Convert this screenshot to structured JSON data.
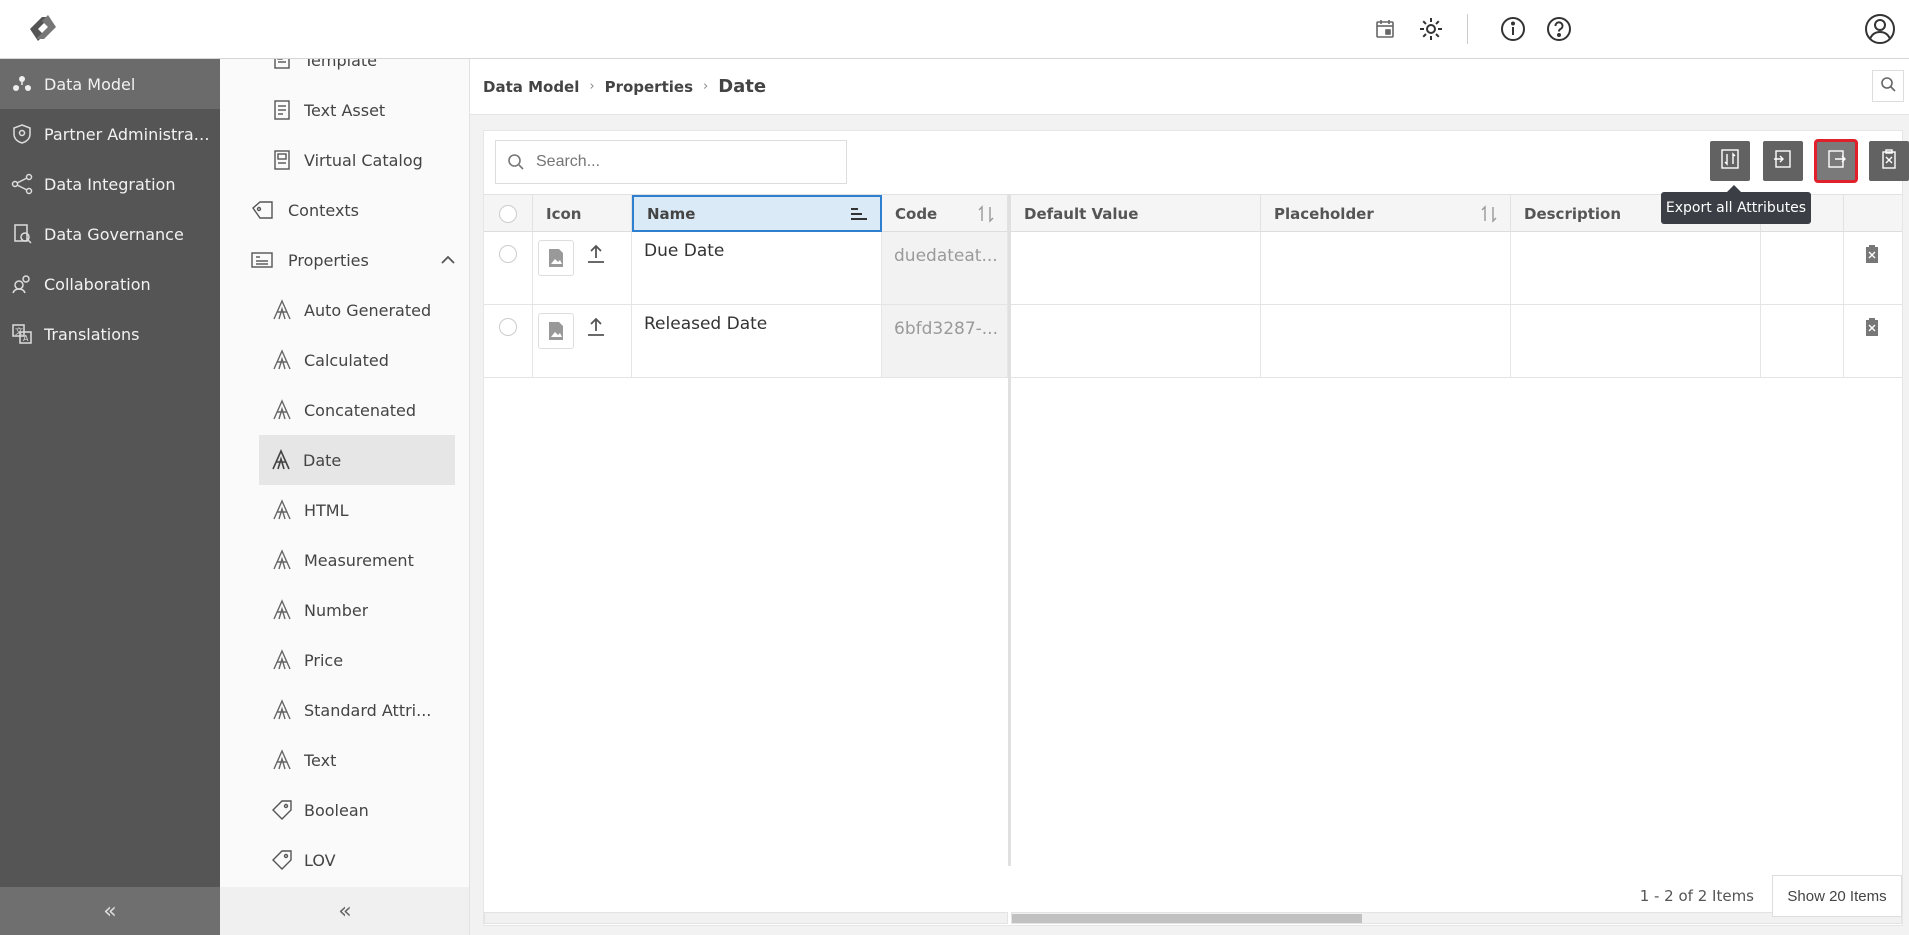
{
  "topbar": {
    "icons": [
      "logo-icon",
      "calendar-icon",
      "gear-icon",
      "info-icon",
      "help-icon",
      "user-icon"
    ]
  },
  "leftnav": {
    "items": [
      {
        "label": "Data Model",
        "icon": "data-model-icon",
        "active": true
      },
      {
        "label": "Partner Administrati...",
        "icon": "shield-icon",
        "active": false
      },
      {
        "label": "Data Integration",
        "icon": "integration-icon",
        "active": false
      },
      {
        "label": "Data Governance",
        "icon": "governance-icon",
        "active": false
      },
      {
        "label": "Collaboration",
        "icon": "collaboration-icon",
        "active": false
      },
      {
        "label": "Translations",
        "icon": "translations-icon",
        "active": false
      }
    ],
    "collapse": "«"
  },
  "subnav": {
    "items": [
      {
        "label": "Template",
        "level": 2,
        "icon": "template-icon"
      },
      {
        "label": "Text Asset",
        "level": 2,
        "icon": "text-asset-icon"
      },
      {
        "label": "Virtual Catalog",
        "level": 2,
        "icon": "catalog-icon"
      },
      {
        "label": "Contexts",
        "level": 1,
        "icon": "tag-icon"
      },
      {
        "label": "Properties",
        "level": 1,
        "icon": "properties-icon"
      },
      {
        "label": "Auto Generated",
        "level": 2,
        "icon": "attribute-icon"
      },
      {
        "label": "Calculated",
        "level": 2,
        "icon": "attribute-icon"
      },
      {
        "label": "Concatenated",
        "level": 2,
        "icon": "attribute-icon"
      },
      {
        "label": "Date",
        "level": 2,
        "icon": "attribute-icon",
        "active": true
      },
      {
        "label": "HTML",
        "level": 2,
        "icon": "attribute-icon"
      },
      {
        "label": "Measurement",
        "level": 2,
        "icon": "attribute-icon"
      },
      {
        "label": "Number",
        "level": 2,
        "icon": "attribute-icon"
      },
      {
        "label": "Price",
        "level": 2,
        "icon": "attribute-icon"
      },
      {
        "label": "Standard Attri...",
        "level": 2,
        "icon": "attribute-icon"
      },
      {
        "label": "Text",
        "level": 2,
        "icon": "attribute-icon"
      },
      {
        "label": "Boolean",
        "level": 2,
        "icon": "tag-icon"
      },
      {
        "label": "LOV",
        "level": 2,
        "icon": "tag-icon"
      }
    ],
    "collapse": "«"
  },
  "breadcrumb": {
    "items": [
      "Data Model",
      "Properties"
    ],
    "current": "Date",
    "separator": "›"
  },
  "toolbar": {
    "search_placeholder": "Search...",
    "buttons": [
      "sync-icon",
      "import-icon",
      "export-icon",
      "delete-icon",
      "add-icon"
    ],
    "tooltip": "Export all Attributes"
  },
  "table": {
    "columns": [
      "Icon",
      "Name",
      "Code",
      "Default Value",
      "Placeholder",
      "Description"
    ],
    "rows": [
      {
        "name": "Due Date",
        "code": "duedateat...",
        "default_value": "",
        "placeholder": "",
        "description": ""
      },
      {
        "name": "Released Date",
        "code": "6bfd3287-...",
        "default_value": "",
        "placeholder": "",
        "description": ""
      }
    ]
  },
  "footer": {
    "page_info": "1 - 2 of 2 Items",
    "show_button": "Show 20 Items"
  }
}
